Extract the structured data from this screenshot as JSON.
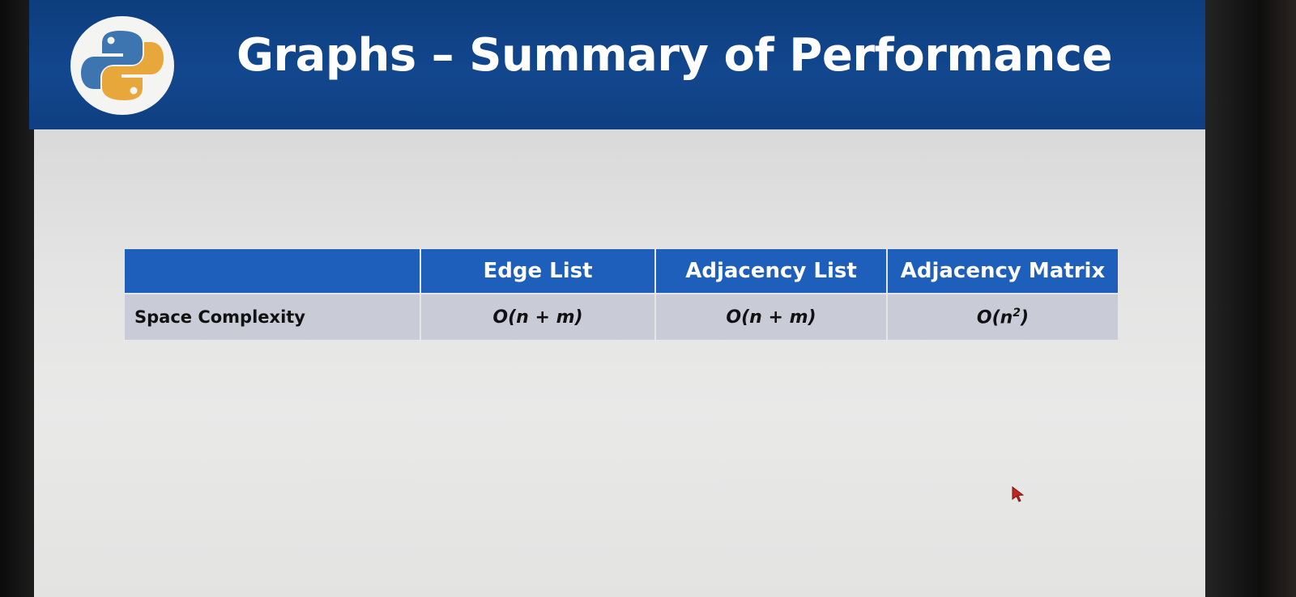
{
  "slide": {
    "title": "Graphs – Summary of Performance",
    "logo_icon": "python-logo-icon"
  },
  "table": {
    "headers": [
      "",
      "Edge List",
      "Adjacency List",
      "Adjacency Matrix"
    ],
    "rows": [
      {
        "label": "Space Complexity",
        "edge_list": "O(n + m)",
        "adjacency_list": "O(n + m)",
        "adjacency_matrix": "O(n",
        "adjacency_matrix_sup": "2",
        "adjacency_matrix_close": ")"
      }
    ]
  },
  "colors": {
    "title_bar": "#12478e",
    "header_cell": "#1f5fbc",
    "body_cell": "#c9ccd6",
    "python_blue": "#3c75b0",
    "python_yellow": "#e8a73a"
  }
}
